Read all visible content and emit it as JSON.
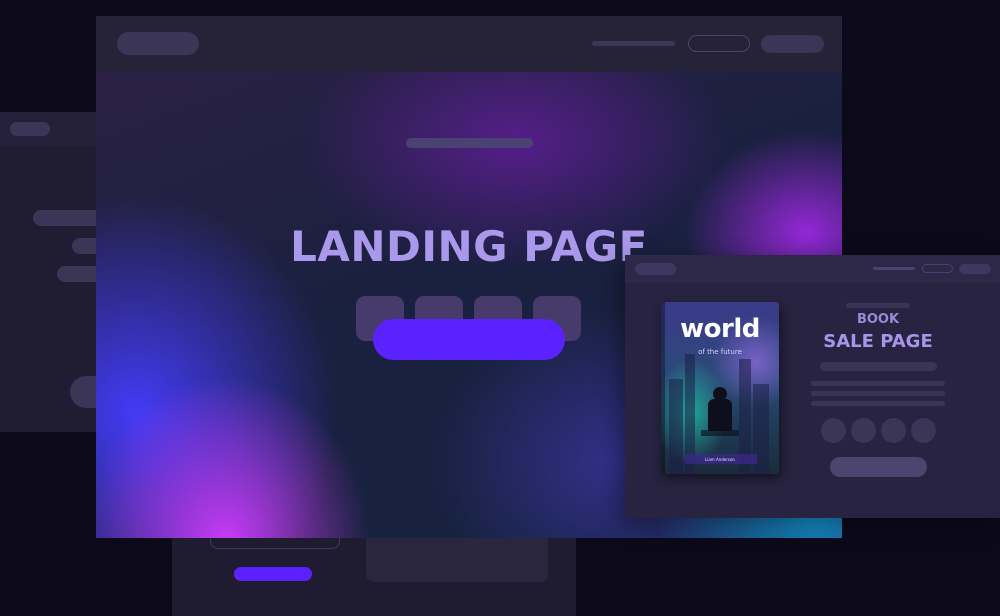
{
  "landing": {
    "title": "LANDING PAGE"
  },
  "book_page": {
    "cover_title": "world",
    "cover_subtitle": "of the future",
    "cover_author": "Liam Anderson",
    "label_small": "BOOK",
    "label_large": "SALE PAGE"
  },
  "colors": {
    "background": "#0c0a1a",
    "window": "#1b1a30",
    "accent_button": "#5b22ff",
    "title_text": "#aa98ea",
    "placeholder": "#463b6a"
  }
}
